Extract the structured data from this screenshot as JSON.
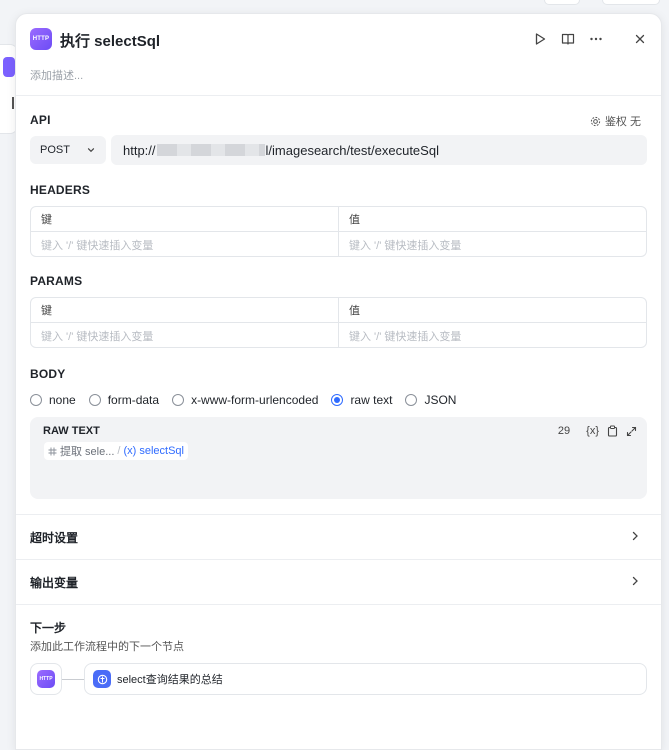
{
  "node": {
    "badge": "HTTP",
    "title": "执行 selectSql",
    "description_placeholder": "添加描述..."
  },
  "api": {
    "label": "API",
    "auth_label": "鉴权 无",
    "method": "POST",
    "url_prefix": "http://",
    "url_suffix": "l/imagesearch/test/executeSql"
  },
  "headers": {
    "label": "HEADERS",
    "key_header": "键",
    "value_header": "值",
    "key_placeholder": "键入 '/' 键快速插入变量",
    "value_placeholder": "键入 '/' 键快速插入变量"
  },
  "params": {
    "label": "PARAMS",
    "key_header": "键",
    "value_header": "值",
    "key_placeholder": "键入 '/' 键快速插入变量",
    "value_placeholder": "键入 '/' 键快速插入变量"
  },
  "body": {
    "label": "BODY",
    "options": [
      "none",
      "form-data",
      "x-www-form-urlencoded",
      "raw text",
      "JSON"
    ],
    "selected": "raw text",
    "raw": {
      "title": "RAW TEXT",
      "char_count": "29",
      "var_button": "{x}",
      "chip_source": "提取 sele...",
      "chip_separator": "/",
      "chip_var": "(x) selectSql"
    }
  },
  "timeout": {
    "label": "超时设置"
  },
  "output": {
    "label": "输出变量"
  },
  "next": {
    "title": "下一步",
    "description": "添加此工作流程中的下一个节点",
    "source_badge": "HTTP",
    "target_label": "select查询结果的总结"
  },
  "colors": {
    "accent": "#2f6bff",
    "node_icon": "#7b61ff"
  }
}
